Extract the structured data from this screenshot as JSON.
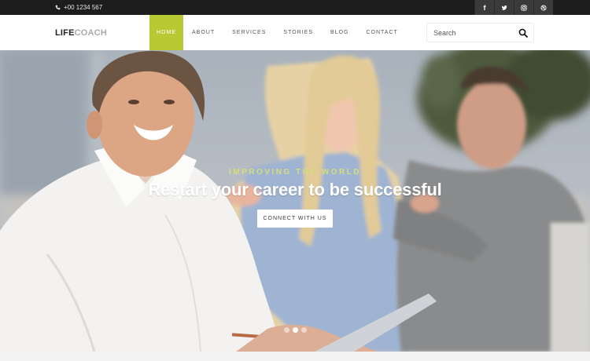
{
  "topbar": {
    "phone": "+00 1234 567",
    "socials": [
      {
        "icon": "facebook-icon",
        "glyph": "f"
      },
      {
        "icon": "twitter-icon",
        "glyph": ""
      },
      {
        "icon": "instagram-icon",
        "glyph": ""
      },
      {
        "icon": "dribbble-icon",
        "glyph": ""
      }
    ]
  },
  "header": {
    "logo_part1": "LIFE",
    "logo_part2": "COACH",
    "menu": [
      {
        "label": "HOME",
        "active": true
      },
      {
        "label": "ABOUT",
        "active": false
      },
      {
        "label": "SERVICES",
        "active": false
      },
      {
        "label": "STORIES",
        "active": false
      },
      {
        "label": "BLOG",
        "active": false
      },
      {
        "label": "CONTACT",
        "active": false
      }
    ],
    "search_placeholder": "Search"
  },
  "hero": {
    "eyebrow": "IMPROVING THE WORLD",
    "headline": "Restart your career to be successful",
    "cta": "CONNECT WITH US",
    "slides": 3,
    "active_slide": 2
  },
  "colors": {
    "accent": "#b8c934",
    "topbar": "#1d1d1d",
    "eyebrow": "#d6de7a"
  }
}
